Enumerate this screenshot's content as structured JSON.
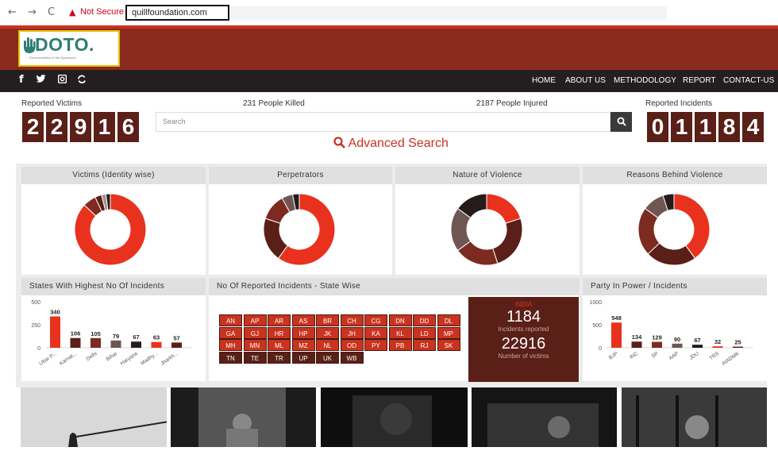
{
  "browser": {
    "back_glyph": "←",
    "forward_glyph": "→",
    "reload_glyph": "C",
    "warning_glyph": "▲",
    "not_secure": "Not Secure",
    "url": "quillfoundation.com"
  },
  "logo": {
    "text": "DOTO.",
    "subtitle": "Documentation of the Oppressed"
  },
  "social": [
    "f",
    "🐦",
    "◙",
    "↻"
  ],
  "nav": [
    "HOME",
    "ABOUT US",
    "METHODOLOGY",
    "REPORT",
    "CONTACT-US"
  ],
  "stats": {
    "reported_victims_label": "Reported Victims",
    "reported_victims_digits": [
      "2",
      "2",
      "9",
      "1",
      "6"
    ],
    "people_killed": "231 People Killed",
    "people_injured": "2187 People Injured",
    "reported_incidents_label": "Reported Incidents",
    "reported_incidents_digits": [
      "0",
      "1",
      "1",
      "8",
      "4"
    ]
  },
  "search": {
    "placeholder": "Search",
    "button_glyph": "🔍",
    "advanced_label": "Advanced Search",
    "advanced_glyph": "🔍"
  },
  "panels": {
    "victims": "Victims (Identity wise)",
    "perpetrators": "Perpetrators",
    "nature": "Nature of Violence",
    "reasons": "Reasons Behind Violence",
    "states_highest": "States With Highest No Of Incidents",
    "state_wise": "No Of Reported Incidents - State Wise",
    "party": "Party In Power / Incidents"
  },
  "colors": {
    "red": "#e8321e",
    "dark_red": "#7d2a20",
    "maroon": "#5a1f17",
    "brown_gray": "#6e5652",
    "near_black": "#241c1b",
    "gray": "#a09090"
  },
  "chart_data": [
    {
      "type": "pie",
      "subtype": "donut",
      "title": "Victims (Identity wise)",
      "values": [
        0.87,
        0.06,
        0.03,
        0.02,
        0.02
      ],
      "colors": [
        "#e8321e",
        "#7d2a20",
        "#5a1f17",
        "#a09090",
        "#241c1b"
      ]
    },
    {
      "type": "pie",
      "subtype": "donut",
      "title": "Perpetrators",
      "values": [
        0.6,
        0.2,
        0.12,
        0.05,
        0.03
      ],
      "colors": [
        "#e8321e",
        "#5a1f17",
        "#7d2a20",
        "#6e5652",
        "#241c1b"
      ]
    },
    {
      "type": "pie",
      "subtype": "donut",
      "title": "Nature of Violence",
      "values": [
        0.2,
        0.25,
        0.2,
        0.2,
        0.15
      ],
      "colors": [
        "#e8321e",
        "#5a1f17",
        "#7d2a20",
        "#6e5652",
        "#241c1b"
      ]
    },
    {
      "type": "pie",
      "subtype": "donut",
      "title": "Reasons Behind Violence",
      "values": [
        0.4,
        0.23,
        0.22,
        0.1,
        0.05
      ],
      "colors": [
        "#e8321e",
        "#5a1f17",
        "#7d2a20",
        "#6e5652",
        "#241c1b"
      ]
    },
    {
      "type": "bar",
      "title": "States With Highest No Of Incidents",
      "categories": [
        "Uttar P...",
        "Karnat...",
        "Delhi",
        "Bihar",
        "Haryana",
        "Madhy...",
        "Jharkh..."
      ],
      "values": [
        340,
        106,
        105,
        79,
        67,
        63,
        57
      ],
      "colors": [
        "#e8321e",
        "#5a1f17",
        "#7d2a20",
        "#6e5652",
        "#241c1b",
        "#e8321e",
        "#5a1f17"
      ],
      "yticks": [
        "0",
        "250",
        "500"
      ],
      "ylim": [
        0,
        500
      ]
    },
    {
      "type": "bar",
      "title": "Party In Power / Incidents",
      "categories": [
        "BJP",
        "INC",
        "SP",
        "AAP",
        "JDU",
        "TRS",
        "AIADMK"
      ],
      "values": [
        548,
        134,
        129,
        90,
        67,
        32,
        25
      ],
      "colors": [
        "#e8321e",
        "#5a1f17",
        "#7d2a20",
        "#6e5652",
        "#241c1b",
        "#e8321e",
        "#5a1f17"
      ],
      "yticks": [
        "0",
        "500",
        "1000"
      ],
      "ylim": [
        0,
        1000
      ]
    }
  ],
  "states": [
    [
      "AN",
      "AP",
      "AR",
      "AS",
      "BR",
      "CH",
      "CG",
      "DN",
      "DD",
      "DL"
    ],
    [
      "GA",
      "GJ",
      "HR",
      "HP",
      "JK",
      "JH",
      "KA",
      "KL",
      "LD",
      "MP"
    ],
    [
      "MH",
      "MN",
      "ML",
      "MZ",
      "NL",
      "OD",
      "PY",
      "PB",
      "RJ",
      "SK"
    ],
    [
      "TN",
      "TE",
      "TR",
      "UP",
      "UK",
      "WB"
    ]
  ],
  "india": {
    "title": "INDIA",
    "incidents": "1184",
    "incidents_label": "Incidents reported",
    "victims": "22916",
    "victims_label": "Number of victims"
  }
}
